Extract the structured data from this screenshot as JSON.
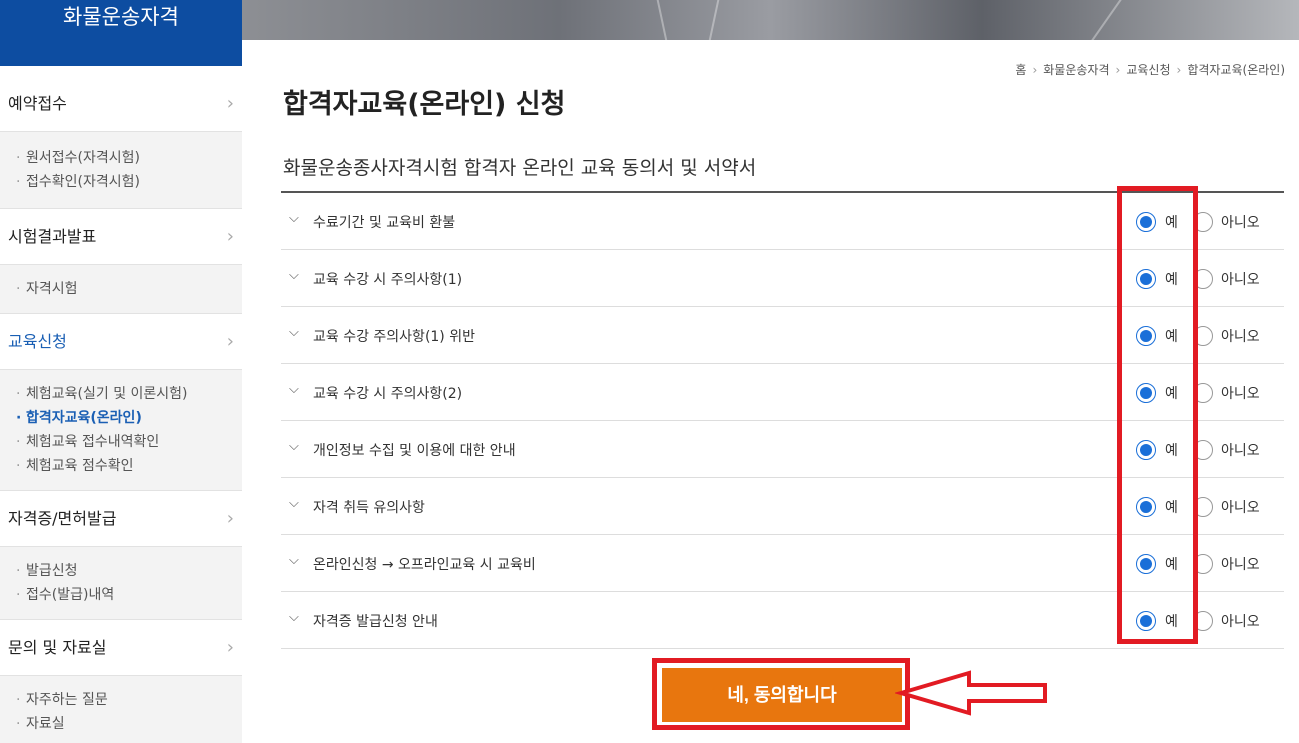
{
  "sidebar": {
    "title": "화물운송자격",
    "sections": [
      {
        "label": "예약접수",
        "items": [
          "원서접수(자격시험)",
          "접수확인(자격시험)"
        ]
      },
      {
        "label": "시험결과발표",
        "items": [
          "자격시험"
        ]
      },
      {
        "label": "교육신청",
        "items": [
          "체험교육(실기 및 이론시험)",
          "합격자교육(온라인)",
          "체험교육 접수내역확인",
          "체험교육 점수확인"
        ]
      },
      {
        "label": "자격증/면허발급",
        "items": [
          "발급신청",
          "접수(발급)내역"
        ]
      },
      {
        "label": "문의 및 자료실",
        "items": [
          "자주하는 질문",
          "자료실"
        ]
      }
    ],
    "active_section": "교육신청",
    "active_item": "합격자교육(온라인)"
  },
  "breadcrumb": [
    "홈",
    "화물운송자격",
    "교육신청",
    "합격자교육(온라인)"
  ],
  "page_title": "합격자교육(온라인) 신청",
  "section_title": "화물운송종사자격시험 합격자 온라인 교육 동의서 및 서약서",
  "yes_label": "예",
  "no_label": "아니오",
  "rows": [
    {
      "label": "수료기간 및 교육비 환불",
      "selected": "예"
    },
    {
      "label": "교육 수강 시 주의사항(1)",
      "selected": "예"
    },
    {
      "label": "교육 수강 주의사항(1) 위반",
      "selected": "예"
    },
    {
      "label": "교육 수강 시 주의사항(2)",
      "selected": "예"
    },
    {
      "label": "개인정보 수집 및 이용에 대한 안내",
      "selected": "예"
    },
    {
      "label": "자격 취득 유의사항",
      "selected": "예"
    },
    {
      "label": "온라인신청 → 오프라인교육 시 교육비",
      "selected": "예"
    },
    {
      "label": "자격증 발급신청 안내",
      "selected": "예"
    }
  ],
  "agree_button": "네, 동의합니다",
  "colors": {
    "brand": "#0d4da1",
    "accent": "#e8760e",
    "highlight": "#e21b23",
    "radio": "#1a6fd8"
  }
}
